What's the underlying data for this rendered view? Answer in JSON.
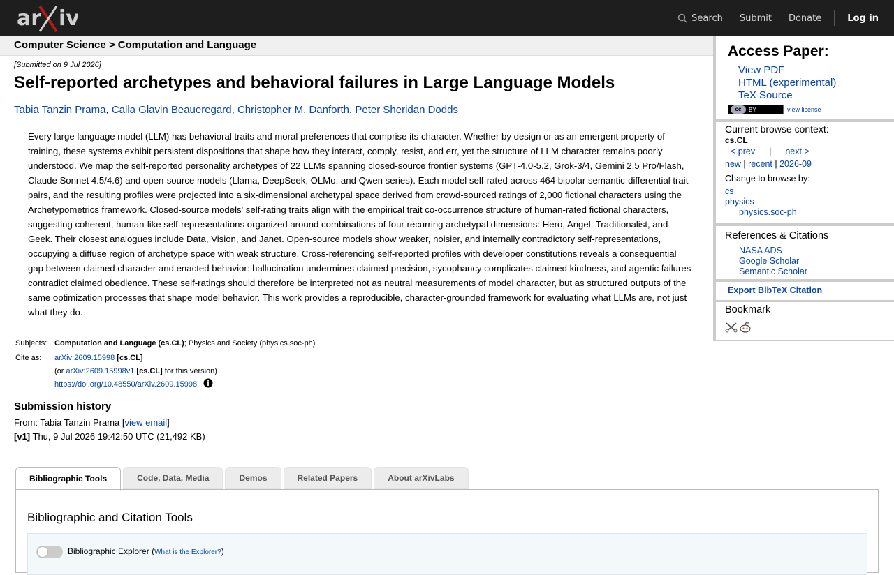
{
  "topbar": {
    "logo_text": "arXiv",
    "search_label": "Search",
    "submit_label": "Submit",
    "donate_label": "Donate",
    "login_label": "Log in"
  },
  "breadcrumb": {
    "text": "Computer Science > Computation and Language"
  },
  "paper": {
    "submitted": "[Submitted on 9 Jul 2026]",
    "title": "Self-reported archetypes and behavioral failures in Large Language Models",
    "authors": [
      "Tabia Tanzin Prama",
      "Calla Glavin Beaueregard",
      "Christopher M. Danforth",
      "Peter Sheridan Dodds"
    ],
    "abstract": "Every large language model (LLM) has behavioral traits and moral preferences that comprise its character. Whether by design or as an emergent property of training, these systems exhibit persistent dispositions that shape how they interact, comply, resist, and err, yet the structure of LLM character remains poorly understood. We map the self-reported personality archetypes of 22 LLMs spanning closed-source frontier systems (GPT-4.0-5.2, Grok-3/4, Gemini 2.5 Pro/Flash, Claude Sonnet 4.5/4.6) and open-source models (Llama, DeepSeek, OLMo, and Qwen series). Each model self-rated across 464 bipolar semantic-differential trait pairs, and the resulting profiles were projected into a six-dimensional archetypal space derived from crowd-sourced ratings of 2,000 fictional characters using the Archetypometrics framework. Closed-source models' self-rating traits align with the empirical trait co-occurrence structure of human-rated fictional characters, suggesting coherent, human-like self-representations organized around combinations of four recurring archetypal dimensions: Hero, Angel, Traditionalist, and Geek. Their closest analogues include Data, Vision, and Janet. Open-source models show weaker, noisier, and internally contradictory self-representations, occupying a diffuse region of archetype space with weak structure. Cross-referencing self-reported profiles with developer constitutions reveals a consequential gap between claimed character and enacted behavior: hallucination undermines claimed precision, sycophancy complicates claimed kindness, and agentic failures contradict claimed obedience. These self-ratings should therefore be interpreted not as neutral measurements of model character, but as structured outputs of the same optimization processes that shape model behavior. This work provides a reproducible, character-grounded framework for evaluating what LLMs are, not just what they do."
  },
  "meta": {
    "subjects_label": "Subjects:",
    "subjects_primary": "Computation and Language (cs.CL)",
    "subjects_rest": "; Physics and Society (physics.soc-ph)",
    "cite_label": "Cite as:",
    "cite_id": "arXiv:2609.15998",
    "cite_cat": "[cs.CL]",
    "or_prefix": "(or ",
    "version_id": "arXiv:2609.15998v1",
    "version_cat": "[cs.CL]",
    "version_suffix": " for this version)",
    "doi": "https://doi.org/10.48550/arXiv.2609.15998"
  },
  "history": {
    "title": "Submission history",
    "from_prefix": "From: Tabia Tanzin Prama [",
    "view_email": "view email",
    "from_suffix": "]",
    "v1_label": "[v1]",
    "v1_text": " Thu, 9 Jul 2026 19:42:50 UTC (21,492 KB)"
  },
  "tabs": [
    "Bibliographic Tools",
    "Code, Data, Media",
    "Demos",
    "Related Papers",
    "About arXivLabs"
  ],
  "panel": {
    "title": "Bibliographic and Citation Tools",
    "explorer_label": "Bibliographic Explorer",
    "explorer_open": " (",
    "explorer_link": "What is the Explorer?",
    "explorer_close": ")",
    "explorer_enabled": false
  },
  "sidebar": {
    "access_title": "Access Paper:",
    "access_links": [
      "View PDF",
      "HTML (experimental)",
      "TeX Source"
    ],
    "license_badge_cc": "cc",
    "license_badge_by": "BY",
    "license_link": "view license",
    "context_title": "Current browse context:",
    "context_cat": "cs.CL",
    "prev": "< prev",
    "sep": "|",
    "next": "next >",
    "new": "new",
    "recent": "recent",
    "month": "2026-09",
    "pipe": " | ",
    "change_label": "Change to browse by:",
    "browse_cs": "cs",
    "browse_physics": "physics",
    "browse_socph": "physics.soc-ph",
    "refs_title": "References & Citations",
    "refs_links": [
      "NASA ADS",
      "Google Scholar",
      "Semantic Scholar"
    ],
    "bibtex": "Export BibTeX Citation",
    "bookmark_title": "Bookmark"
  },
  "colors": {
    "topbar_bg": "#1e1e1e",
    "logo_x_red": "#b31b1b",
    "link_blue": "#0645ad"
  }
}
